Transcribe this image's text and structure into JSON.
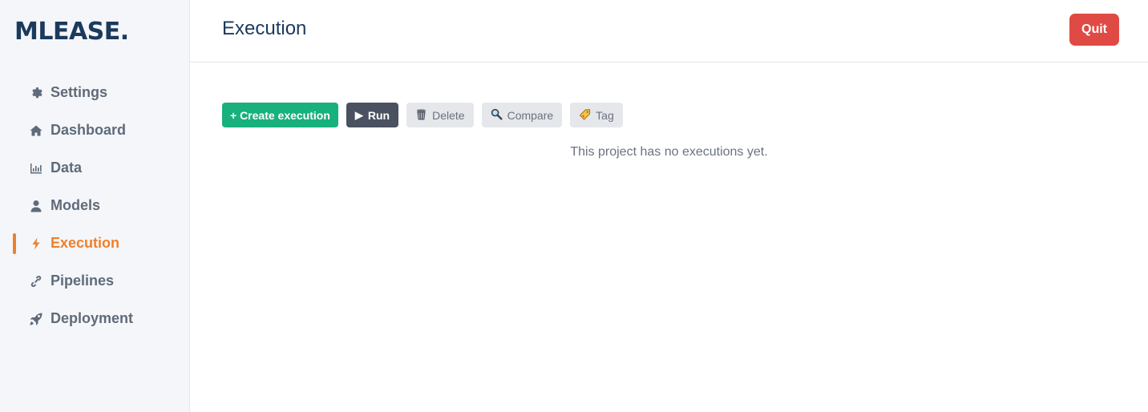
{
  "app": {
    "logo": "MLEASE."
  },
  "sidebar": {
    "items": [
      {
        "label": "Settings",
        "icon": "gear-icon",
        "active": false
      },
      {
        "label": "Dashboard",
        "icon": "home-icon",
        "active": false
      },
      {
        "label": "Data",
        "icon": "bar-chart-icon",
        "active": false
      },
      {
        "label": "Models",
        "icon": "user-icon",
        "active": false
      },
      {
        "label": "Execution",
        "icon": "bolt-icon",
        "active": true
      },
      {
        "label": "Pipelines",
        "icon": "link-icon",
        "active": false
      },
      {
        "label": "Deployment",
        "icon": "rocket-icon",
        "active": false
      }
    ]
  },
  "header": {
    "title": "Execution",
    "quit_label": "Quit"
  },
  "toolbar": {
    "create_label": "+ Create execution",
    "run_label": "Run",
    "run_icon": "play-icon",
    "delete_label": "Delete",
    "delete_icon": "trash-icon",
    "compare_label": "Compare",
    "compare_icon": "magnifier-icon",
    "tag_label": "Tag",
    "tag_icon": "tag-icon"
  },
  "main": {
    "empty_message": "This project has no executions yet."
  },
  "colors": {
    "accent": "#f07f2a",
    "brand": "#1b3a5c",
    "create": "#18b07c",
    "run": "#4a5160",
    "quit": "#e04a45"
  }
}
